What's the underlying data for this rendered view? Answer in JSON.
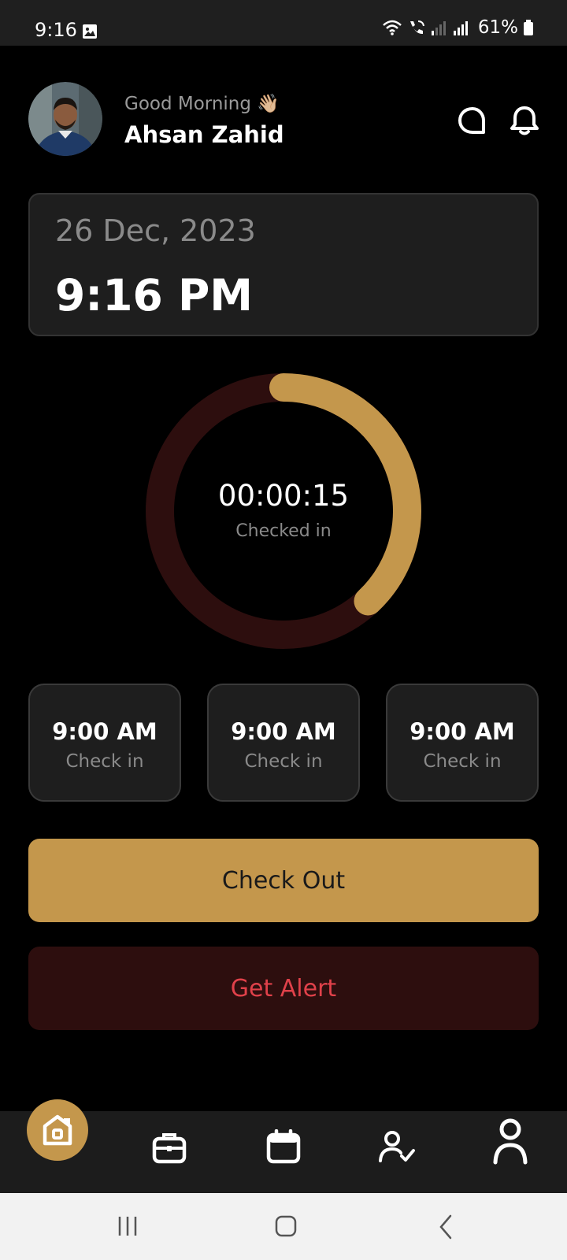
{
  "status_bar": {
    "time": "9:16",
    "battery": "61%"
  },
  "header": {
    "greeting": "Good Morning 👋🏼",
    "name": "Ahsan Zahid"
  },
  "date_card": {
    "date": "26 Dec, 2023",
    "time": "9:16 PM"
  },
  "timer": {
    "elapsed": "00:00:15",
    "label": "Checked in",
    "progress_fraction": 0.38
  },
  "slots": [
    {
      "time": "9:00 AM",
      "label": "Check in"
    },
    {
      "time": "9:00 AM",
      "label": "Check in"
    },
    {
      "time": "9:00 AM",
      "label": "Check in"
    }
  ],
  "actions": {
    "checkout": "Check Out",
    "alert": "Get Alert"
  },
  "nav": {
    "items": [
      "home-icon",
      "briefcase-icon",
      "calendar-icon",
      "user-check-icon",
      "profile-icon"
    ],
    "active": "home-icon"
  },
  "colors": {
    "accent": "#c4974c",
    "alert_text": "#e0414a",
    "alert_bg": "#2d0e0e",
    "ring_track": "#2d0e0e"
  }
}
